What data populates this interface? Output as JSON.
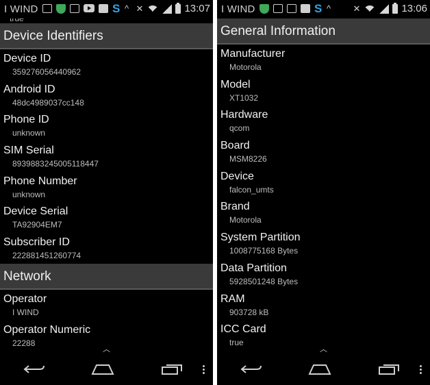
{
  "left": {
    "status": {
      "carrier": "I WIND",
      "time": "13:07"
    },
    "peek_value": "true",
    "sections": [
      {
        "title": "Device Identifiers",
        "items": [
          {
            "label": "Device ID",
            "value": "359276056440962"
          },
          {
            "label": "Android ID",
            "value": "48dc4989037cc148"
          },
          {
            "label": "Phone ID",
            "value": "unknown"
          },
          {
            "label": "SIM Serial",
            "value": "8939883245005118447"
          },
          {
            "label": "Phone Number",
            "value": "unknown"
          },
          {
            "label": "Device Serial",
            "value": "TA92904EM7"
          },
          {
            "label": "Subscriber ID",
            "value": "222881451260774"
          }
        ]
      },
      {
        "title": "Network",
        "items": [
          {
            "label": "Operator",
            "value": "I WIND"
          },
          {
            "label": "Operator Numeric",
            "value": "22288"
          }
        ]
      }
    ]
  },
  "right": {
    "status": {
      "carrier": "I WIND",
      "time": "13:06"
    },
    "sections": [
      {
        "title": "General Information",
        "items": [
          {
            "label": "Manufacturer",
            "value": "Motorola"
          },
          {
            "label": "Model",
            "value": "XT1032"
          },
          {
            "label": "Hardware",
            "value": "qcom"
          },
          {
            "label": "Board",
            "value": "MSM8226"
          },
          {
            "label": "Device",
            "value": "falcon_umts"
          },
          {
            "label": "Brand",
            "value": "Motorola"
          },
          {
            "label": "System Partition",
            "value": "1008775168 Bytes"
          },
          {
            "label": "Data Partition",
            "value": "5928501248 Bytes"
          },
          {
            "label": "RAM",
            "value": "903728 kB"
          },
          {
            "label": "ICC Card",
            "value": "true"
          }
        ]
      }
    ]
  },
  "icons": {
    "status_left": [
      "image-icon",
      "shield-icon",
      "grid-icon",
      "youtube-icon",
      "outlook-icon",
      "s-app-icon",
      "chevron-up-icon"
    ],
    "status_right": [
      "mute-icon",
      "wifi-icon",
      "signal-icon",
      "battery-icon"
    ],
    "nav": [
      "back-icon",
      "home-icon",
      "recents-icon",
      "menu-dots-icon"
    ]
  },
  "colors": {
    "section_bg": "#3a3a3a",
    "shield": "#3fa85a",
    "s_app": "#35a3e3"
  }
}
